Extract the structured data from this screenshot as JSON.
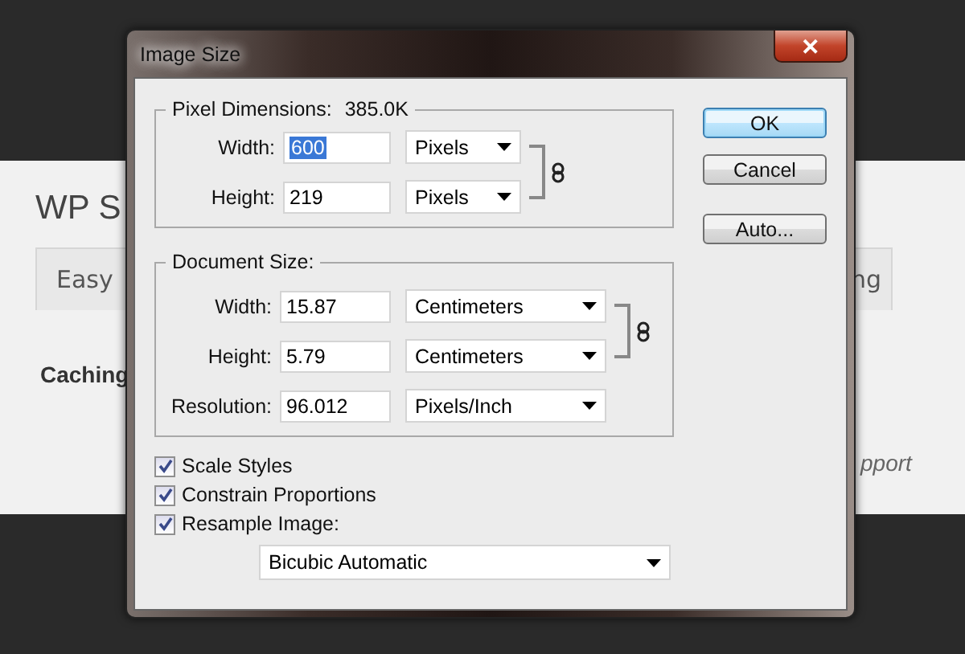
{
  "background": {
    "heading": "WP S",
    "tabs": [
      {
        "label": "Easy"
      },
      {
        "label": "ng"
      }
    ],
    "section_label": "Caching",
    "link_fragment": "pport"
  },
  "window": {
    "title": "Image Size",
    "close": "✕"
  },
  "pixel_dimensions": {
    "label": "Pixel Dimensions:",
    "size": "385.0K",
    "linked": true,
    "rows": [
      {
        "label": "Width:",
        "value": "600",
        "value_selected": true,
        "unit": "Pixels"
      },
      {
        "label": "Height:",
        "value": "219",
        "value_selected": false,
        "unit": "Pixels"
      }
    ]
  },
  "document_size": {
    "label": "Document Size:",
    "linked": true,
    "rows": [
      {
        "label": "Width:",
        "value": "15.87",
        "value_selected": false,
        "unit": "Centimeters"
      },
      {
        "label": "Height:",
        "value": "5.79",
        "value_selected": false,
        "unit": "Centimeters"
      },
      {
        "label": "Resolution:",
        "value": "96.012",
        "value_selected": false,
        "unit": "Pixels/Inch"
      }
    ]
  },
  "options": [
    {
      "label": "Scale Styles",
      "checked": true
    },
    {
      "label": "Constrain Proportions",
      "checked": true
    },
    {
      "label": "Resample Image:",
      "checked": true
    }
  ],
  "resample_method": "Bicubic Automatic",
  "buttons": [
    {
      "label": "OK",
      "default": true
    },
    {
      "label": "Cancel",
      "default": false
    },
    {
      "label": "Auto...",
      "default": false
    }
  ]
}
